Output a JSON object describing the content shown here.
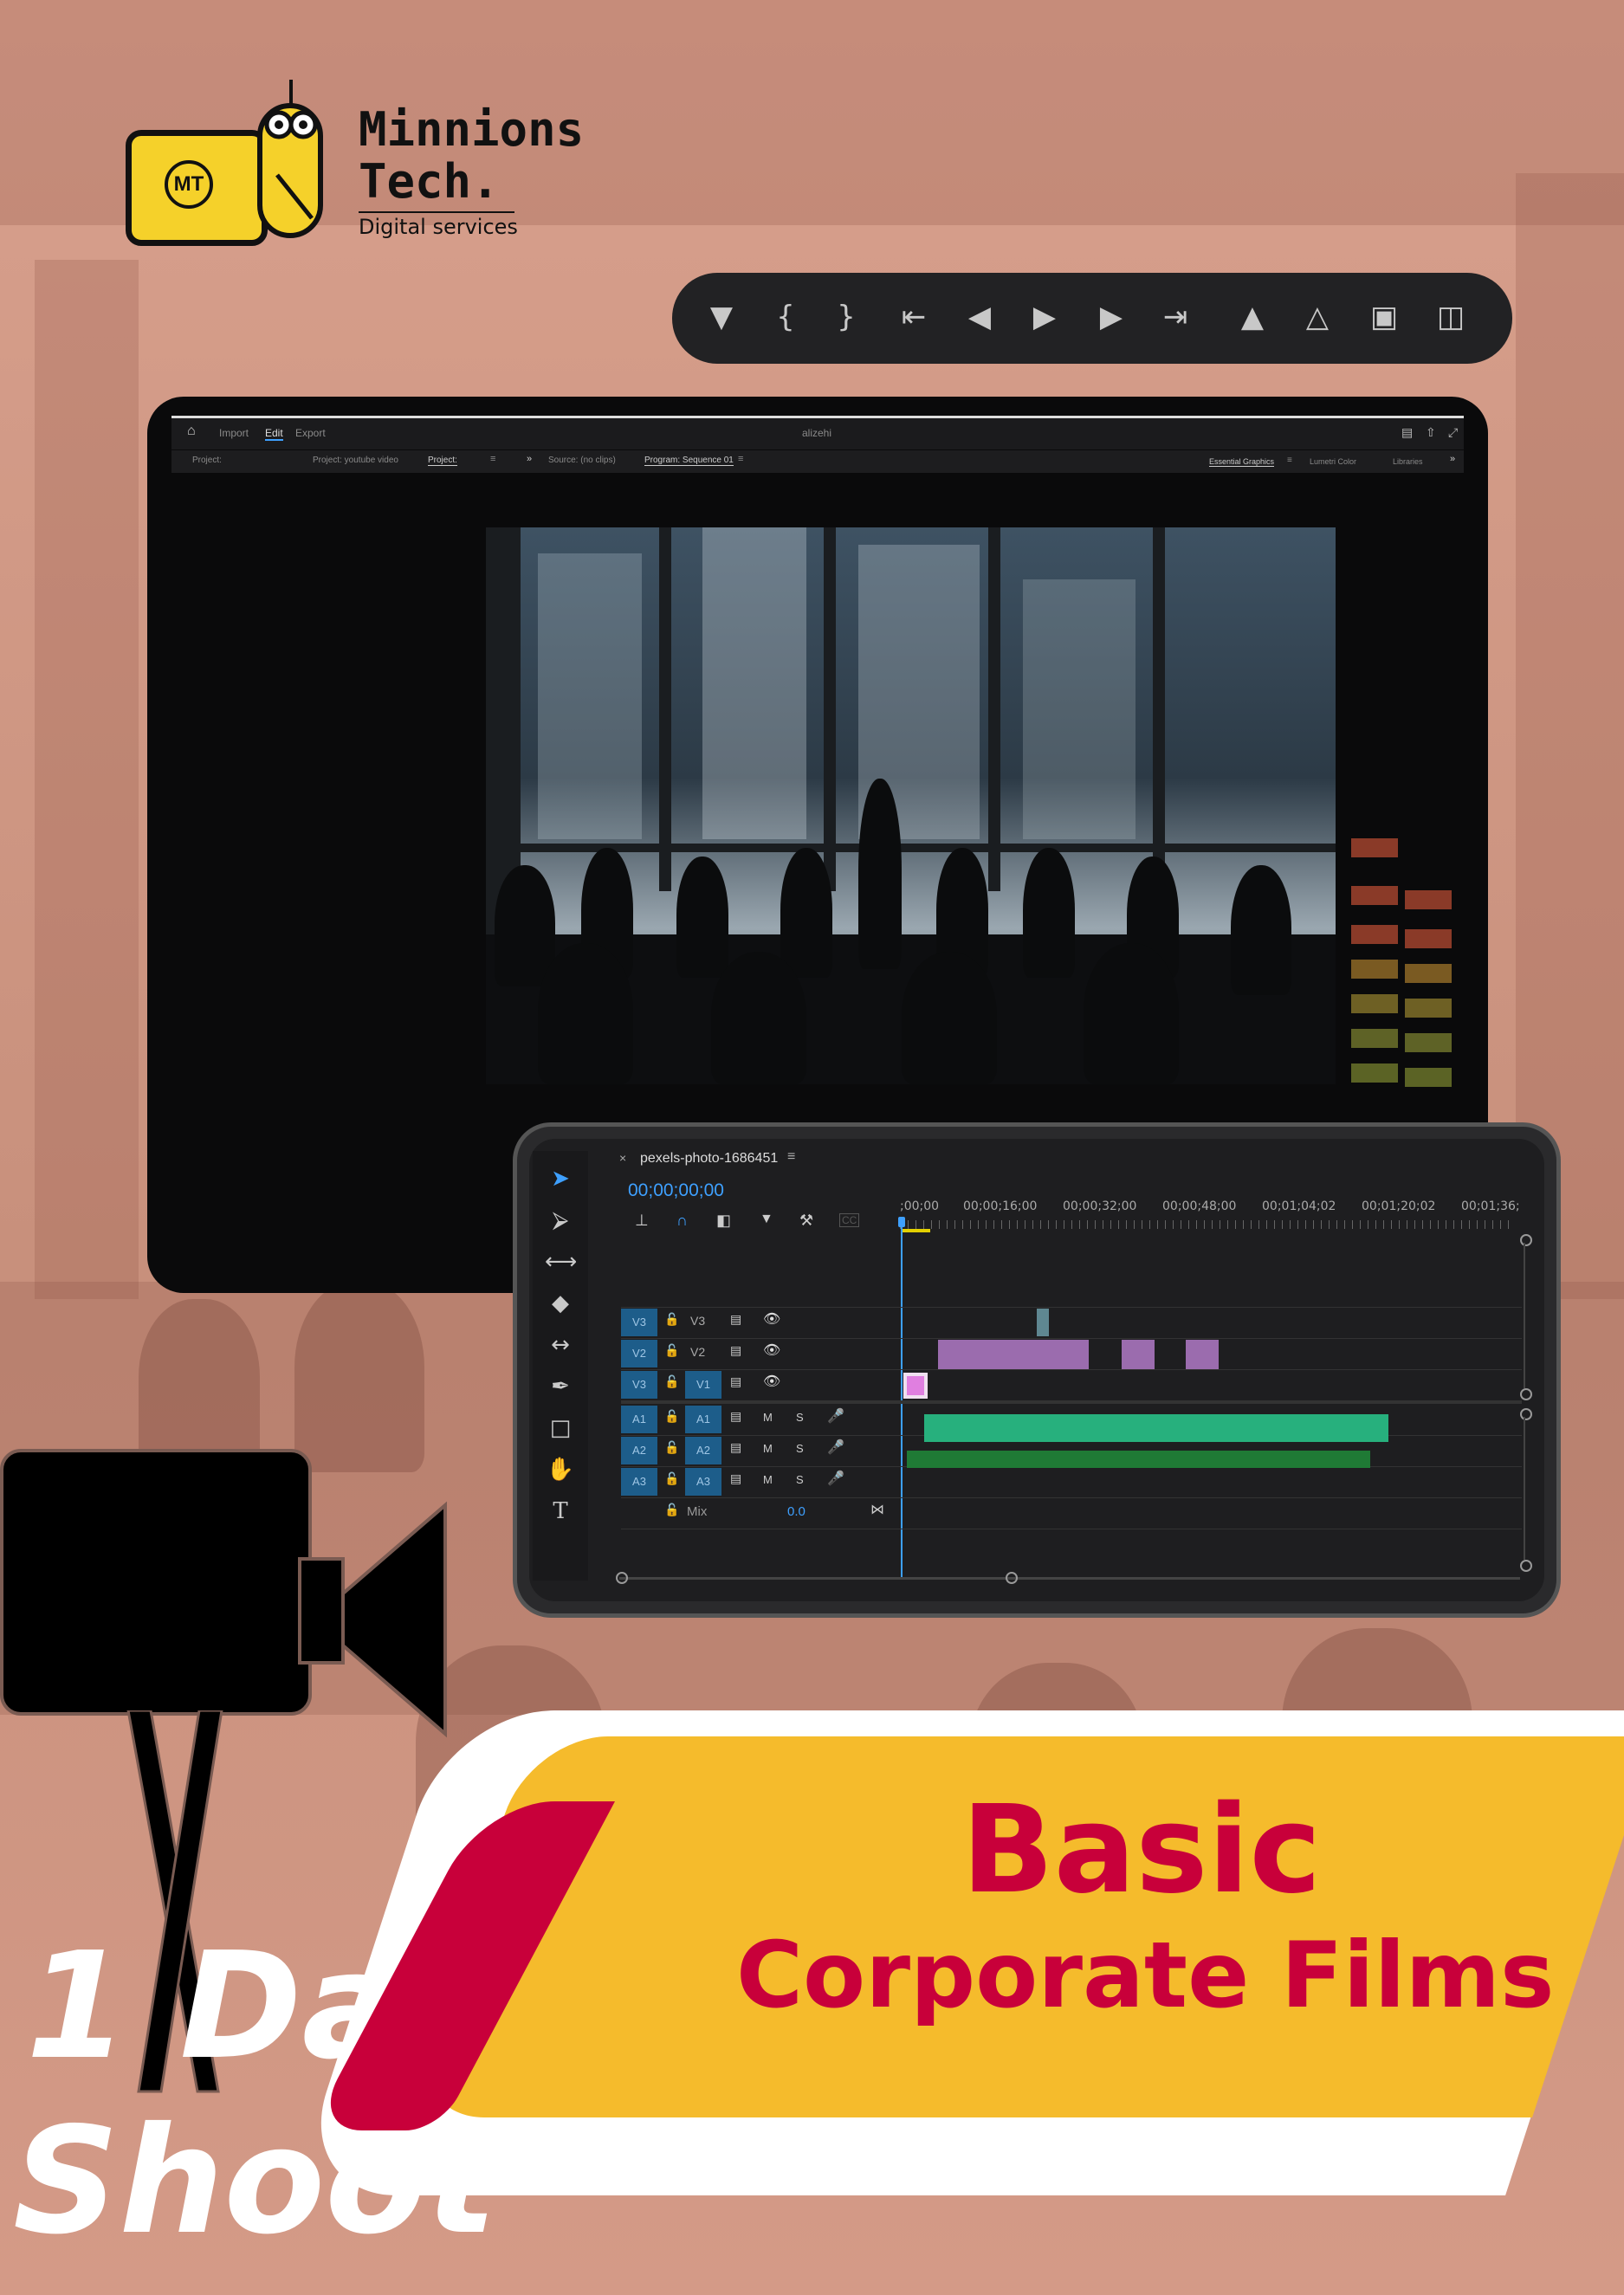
{
  "brand": {
    "logo_mark": "MT",
    "name_line1": "Minnions",
    "name_line2": "Tech.",
    "tagline": "Digital services"
  },
  "transport_icons": [
    "marker-icon",
    "mark-in-icon",
    "mark-out-icon",
    "go-to-in-icon",
    "step-back-icon",
    "play-icon",
    "step-forward-icon",
    "go-to-out-icon",
    "lift-icon",
    "extract-icon",
    "export-frame-icon",
    "comparison-view-icon"
  ],
  "app": {
    "tabs": [
      "Import",
      "Edit",
      "Export"
    ],
    "active_tab": "Edit",
    "title": "alizehi",
    "panels": {
      "project": "Project:",
      "project_file": "Project: youtube video",
      "project_short": "Project:",
      "source": "Source: (no clips)",
      "program": "Program: Sequence 01",
      "essential_graphics": "Essential Graphics",
      "lumetri": "Lumetri Color",
      "libraries": "Libraries"
    }
  },
  "timeline": {
    "sequence_name": "pexels-photo-1686451",
    "timecode": "00;00;00;00",
    "ruler": [
      ";00;00",
      "00;00;16;00",
      "00;00;32;00",
      "00;00;48;00",
      "00;01;04;02",
      "00;01;20;02",
      "00;01;36;"
    ],
    "video_tracks": [
      {
        "src": "V3",
        "target": "V3"
      },
      {
        "src": "V2",
        "target": "V2"
      },
      {
        "src": "V3",
        "target": "V1"
      }
    ],
    "audio_tracks": [
      {
        "src": "A1",
        "target": "A1",
        "m": "M",
        "s": "S"
      },
      {
        "src": "A2",
        "target": "A2",
        "m": "M",
        "s": "S"
      },
      {
        "src": "A3",
        "target": "A3",
        "m": "M",
        "s": "S"
      }
    ],
    "mix_label": "Mix",
    "mix_value": "0.0",
    "colors": {
      "video_clip": "#9b6cae",
      "audio_clip": "#27b07d",
      "audio_clip_2": "#1f7a35",
      "track_button": "#1d5d8a",
      "playhead": "#3ea0ff"
    }
  },
  "headline": {
    "line1": "Basic",
    "line2": "Corporate Films"
  },
  "side_text": {
    "line1": "1 Day",
    "line2": "Shoot"
  },
  "colors": {
    "accent_red": "#c8003a",
    "accent_yellow": "#f5bb2c",
    "background": "#d49a87"
  }
}
